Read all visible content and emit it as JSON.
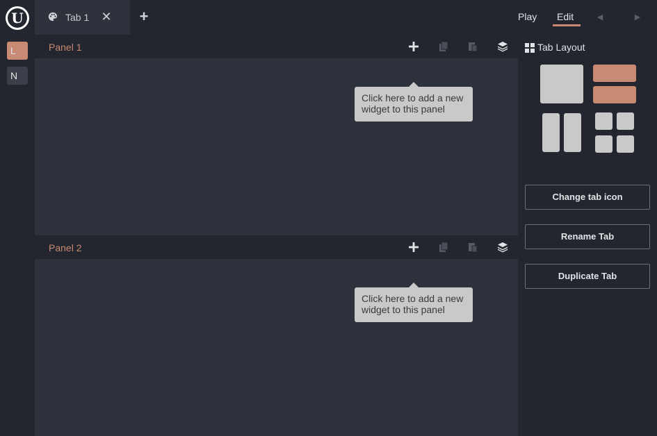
{
  "header": {
    "logo_letter": "U",
    "tab_label": "Tab 1",
    "close_glyph": "✕",
    "add_glyph": "+",
    "mode_play": "Play",
    "mode_edit": "Edit",
    "active_mode": "Edit",
    "prev_glyph": "◀",
    "next_glyph": "▶"
  },
  "rail": {
    "items": [
      {
        "label": "L",
        "active": true
      },
      {
        "label": "N",
        "active": false
      }
    ]
  },
  "panels": [
    {
      "title": "Panel 1",
      "tooltip": "Click here to add a new widget to this panel"
    },
    {
      "title": "Panel 2",
      "tooltip": "Click here to add a new widget to this panel"
    }
  ],
  "sidebar": {
    "title": "Tab Layout",
    "buttons": {
      "change_icon": "Change tab icon",
      "rename": "Rename Tab",
      "duplicate": "Duplicate Tab"
    },
    "selected_layout": "two-rows"
  },
  "colors": {
    "accent": "#c98a73",
    "background": "#23262f",
    "panel": "#2e323c",
    "layout_tile": "#c9c9c9"
  },
  "icons": {
    "tab": "palette-icon",
    "add": "plus-icon",
    "copy": "copy-icon",
    "paste": "paste-icon",
    "layers": "layers-icon",
    "layout": "grid-icon"
  }
}
